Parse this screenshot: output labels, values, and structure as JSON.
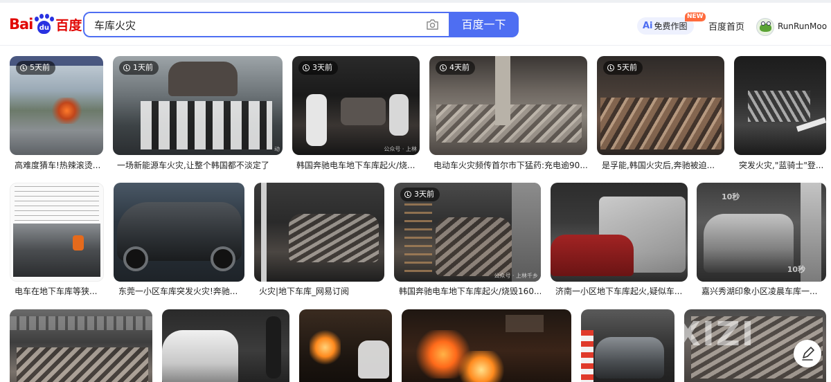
{
  "header": {
    "logo_text_left": "Bai",
    "logo_text_paw": "du",
    "logo_text_right": "百度",
    "search_query": "车库火灾",
    "search_button": "百度一下",
    "ai_label": "免费作图",
    "ai_prefix": "Ai",
    "new_badge": "NEW",
    "home_link": "百度首页",
    "username": "RunRunMoo"
  },
  "results": [
    {
      "caption": "高难度猜车!热辣滚烫...",
      "time": "5天前"
    },
    {
      "caption": "一场新能源车火灾,让整个韩国都不淡定了",
      "time": "1天前"
    },
    {
      "caption": "韩国奔驰电车地下车库起火/烧...",
      "time": "3天前"
    },
    {
      "caption": "电动车火灾频传首尔市下猛药:充电逾90...",
      "time": "4天前"
    },
    {
      "caption": "是孚能,韩国火灾后,奔驰被迫...",
      "time": "5天前"
    },
    {
      "caption": "突发火灾,\"蓝骑士\"登...",
      "time": ""
    },
    {
      "caption": "电车在地下车库等狭...",
      "time": ""
    },
    {
      "caption": "东莞一小区车库突发火灾!奔驰...",
      "time": ""
    },
    {
      "caption": "火灾|地下车库_网易订阅",
      "time": ""
    },
    {
      "caption": "韩国奔驰电车地下车库起火/烧毁160...",
      "time": "3天前"
    },
    {
      "caption": "济南一小区地下车库起火,疑似车...",
      "time": ""
    },
    {
      "caption": "嘉兴秀湖印象小区凌晨车库一...",
      "time": ""
    }
  ],
  "watermarks": {
    "w1": "动",
    "w2": "公众号 · 上林",
    "w3": "公众号 · 上林千乡",
    "w4": "10秒",
    "w5": "10秒",
    "xizi": "XIZI"
  },
  "colors": {
    "brand_blue": "#4e6ef2",
    "brand_red": "#e10602"
  }
}
